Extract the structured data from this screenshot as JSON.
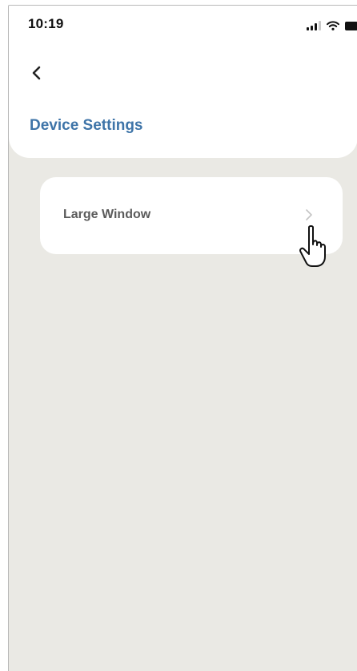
{
  "status_bar": {
    "time": "10:19",
    "icons": [
      "cellular-signal-icon",
      "wifi-icon",
      "battery-icon"
    ]
  },
  "nav": {
    "back_icon": "chevron-left-icon"
  },
  "page": {
    "title": "Device Settings"
  },
  "settings": {
    "items": [
      {
        "label": "Large Window",
        "icon": "chevron-right-icon"
      }
    ]
  },
  "pointer": {
    "icon": "hand-pointer-icon"
  },
  "colors": {
    "title_blue": "#3e74a8",
    "background": "#eae9e4",
    "card": "#ffffff",
    "label_gray": "#5b5b5b"
  }
}
